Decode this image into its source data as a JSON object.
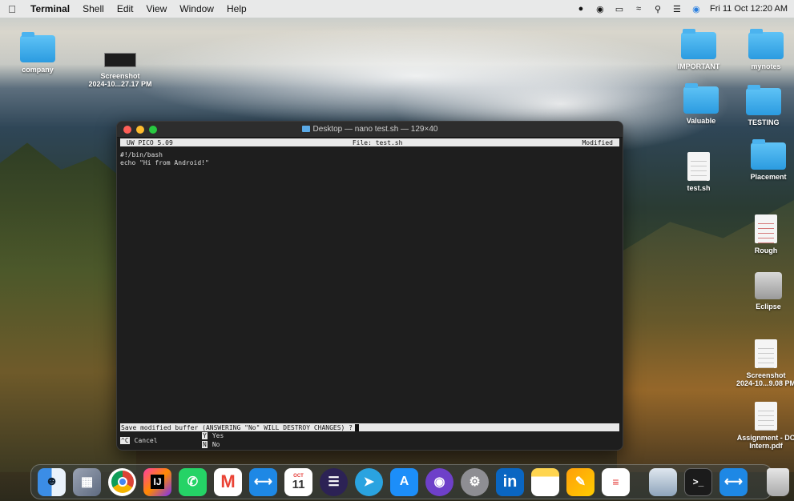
{
  "menubar": {
    "app_name": "Terminal",
    "menus": [
      "Shell",
      "Edit",
      "View",
      "Window",
      "Help"
    ],
    "clock": "Fri 11 Oct  12:20 AM"
  },
  "desktop": {
    "company": "company",
    "screenshot1": {
      "line1": "Screenshot",
      "line2": "2024-10...27.17 PM"
    },
    "important": "IMPORTANT",
    "mynotes": "mynotes",
    "valuable": "Valuable",
    "testing": "TESTING",
    "test_sh": "test.sh",
    "placement": "Placement",
    "rough": "Rough",
    "eclipse": "Eclipse",
    "screenshot2": {
      "line1": "Screenshot",
      "line2": "2024-10...9.08 PM"
    },
    "assignment": {
      "line1": "Assignment - DC",
      "line2": "Intern.pdf"
    }
  },
  "terminal": {
    "title": "Desktop — nano test.sh — 129×40",
    "header_left": "UW PICO 5.09",
    "header_center": "File: test.sh",
    "header_right": "Modified",
    "lines": [
      "#!/bin/bash",
      "echo \"Hi from Android!\""
    ],
    "prompt": "Save modified buffer (ANSWERING \"No\" WILL DESTROY CHANGES) ?",
    "shortcuts": {
      "cancel_key": "^C",
      "cancel_label": "Cancel",
      "yes_key": "Y",
      "yes_label": "Yes",
      "no_key": "N",
      "no_label": "No"
    }
  },
  "dock": {
    "calendar_month": "OCT",
    "calendar_day": "11"
  }
}
